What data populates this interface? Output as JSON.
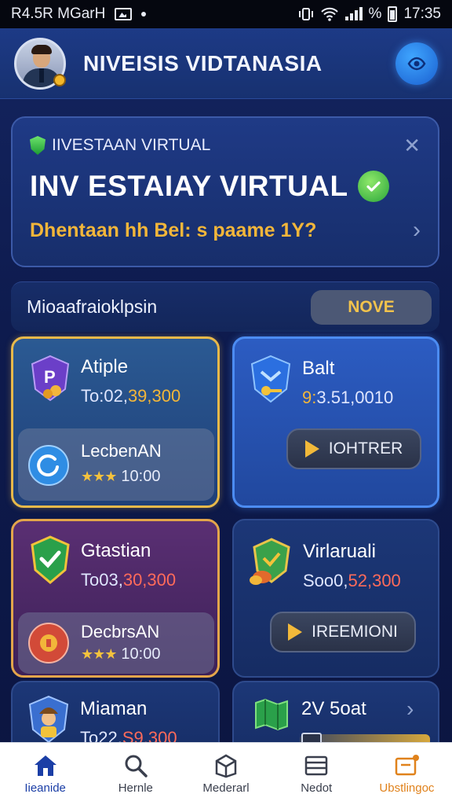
{
  "status_bar": {
    "left_text": "R4.5R MGarH",
    "time": "17:35",
    "icons": [
      "image-icon",
      "dot-icon",
      "vibrate-icon",
      "wifi-icon",
      "signal-icon",
      "percent-icon",
      "battery-icon"
    ]
  },
  "header": {
    "title": "NIVEISIS VIDTANASIA",
    "avatar": "avatar",
    "action_icon": "eye-icon"
  },
  "banner": {
    "small_label": "IIVESTAAN VIRTUAL",
    "heading": "INV ESTAIAY VIRTUAL",
    "subtitle": "Dhentaan hh  Bel: s paame 1Y?",
    "close_icon": "close-icon",
    "chevron_icon": "chevron-right-icon"
  },
  "section": {
    "title": "Mioaafraioklpsin",
    "button_label": "NOVE"
  },
  "cards": [
    {
      "name": "Atiple",
      "value_prefix": "To:02,",
      "value_hl": "39,300",
      "sub_name": "LecbenAN",
      "sub_stars": "★★★",
      "sub_value": "10:00"
    },
    {
      "name": "Balt",
      "value_prefix": "9:",
      "value_hl": "3.51,0010",
      "button_label": "IOHTRER"
    },
    {
      "name": "Gtastian",
      "value_prefix": "To03,",
      "value_hl": "30,300",
      "sub_name": "DecbrsAN",
      "sub_stars": "★★★",
      "sub_value": "10:00"
    },
    {
      "name": "Virlaruali",
      "value_prefix": "Soo0,",
      "value_hl": "52,300",
      "button_label": "IREEMIONI"
    },
    {
      "name": "Miaman",
      "value_prefix": "To22,",
      "value_hl": "S9.300"
    },
    {
      "name": "2V 5oat"
    }
  ],
  "bottom_nav": [
    {
      "label": "Iieanide",
      "icon": "home-icon"
    },
    {
      "label": "Hernle",
      "icon": "search-icon"
    },
    {
      "label": "Mederarl",
      "icon": "package-icon"
    },
    {
      "label": "Nedot",
      "icon": "list-icon"
    },
    {
      "label": "Ubstlingoc",
      "icon": "wallet-icon"
    }
  ],
  "colors": {
    "accent_gold": "#f2b63a",
    "card_gold_border": "#e8b94a",
    "card_blue_border": "#4c8cf2",
    "active_nav": "#1b3ea6",
    "orange_nav": "#e0821c"
  }
}
